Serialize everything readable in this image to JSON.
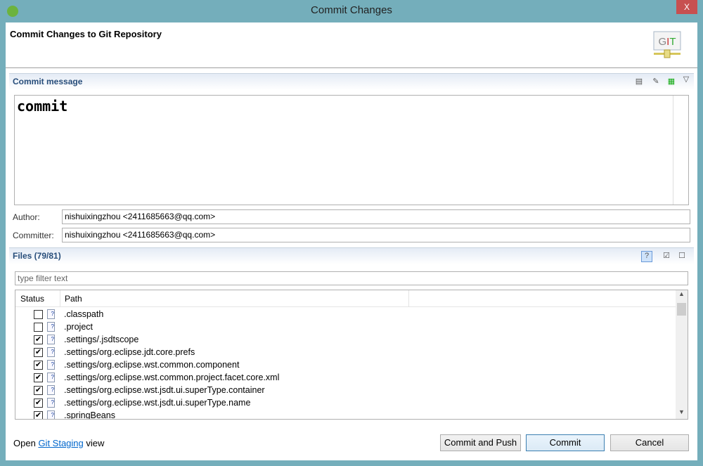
{
  "window": {
    "title": "Commit Changes",
    "close": "X"
  },
  "header": {
    "title": "Commit Changes to Git Repository",
    "logo": "GIT"
  },
  "commit_message": {
    "section": "Commit message",
    "text": "commit",
    "toolbar_icons": [
      "amend-icon",
      "signed-off-icon",
      "change-id-icon",
      "menu-icon"
    ]
  },
  "author": {
    "label": "Author:",
    "value": "nishuixingzhou <2411685663@qq.com>"
  },
  "committer": {
    "label": "Committer:",
    "value": "nishuixingzhou <2411685663@qq.com>"
  },
  "files": {
    "section": "Files (79/81)",
    "filter_placeholder": "type filter text",
    "columns": [
      "Status",
      "Path"
    ],
    "rows": [
      {
        "checked": false,
        "icon": "untracked-xml-file",
        "path": ".classpath"
      },
      {
        "checked": false,
        "icon": "untracked-xml-file",
        "path": ".project"
      },
      {
        "checked": true,
        "icon": "untracked-xml-file",
        "path": ".settings/.jsdtscope"
      },
      {
        "checked": true,
        "icon": "untracked-text-file",
        "path": ".settings/org.eclipse.jdt.core.prefs"
      },
      {
        "checked": true,
        "icon": "untracked-xml-file",
        "path": ".settings/org.eclipse.wst.common.component"
      },
      {
        "checked": true,
        "icon": "untracked-xml-file",
        "path": ".settings/org.eclipse.wst.common.project.facet.core.xml"
      },
      {
        "checked": true,
        "icon": "untracked-text-file",
        "path": ".settings/org.eclipse.wst.jsdt.ui.superType.container"
      },
      {
        "checked": true,
        "icon": "untracked-text-file",
        "path": ".settings/org.eclipse.wst.jsdt.ui.superType.name"
      },
      {
        "checked": true,
        "icon": "untracked-text-file",
        "path": ".springBeans"
      }
    ]
  },
  "footer": {
    "open": "Open",
    "link": "Git Staging",
    "view": "view",
    "commit_and_push": "Commit and Push",
    "commit": "Commit",
    "cancel": "Cancel"
  }
}
